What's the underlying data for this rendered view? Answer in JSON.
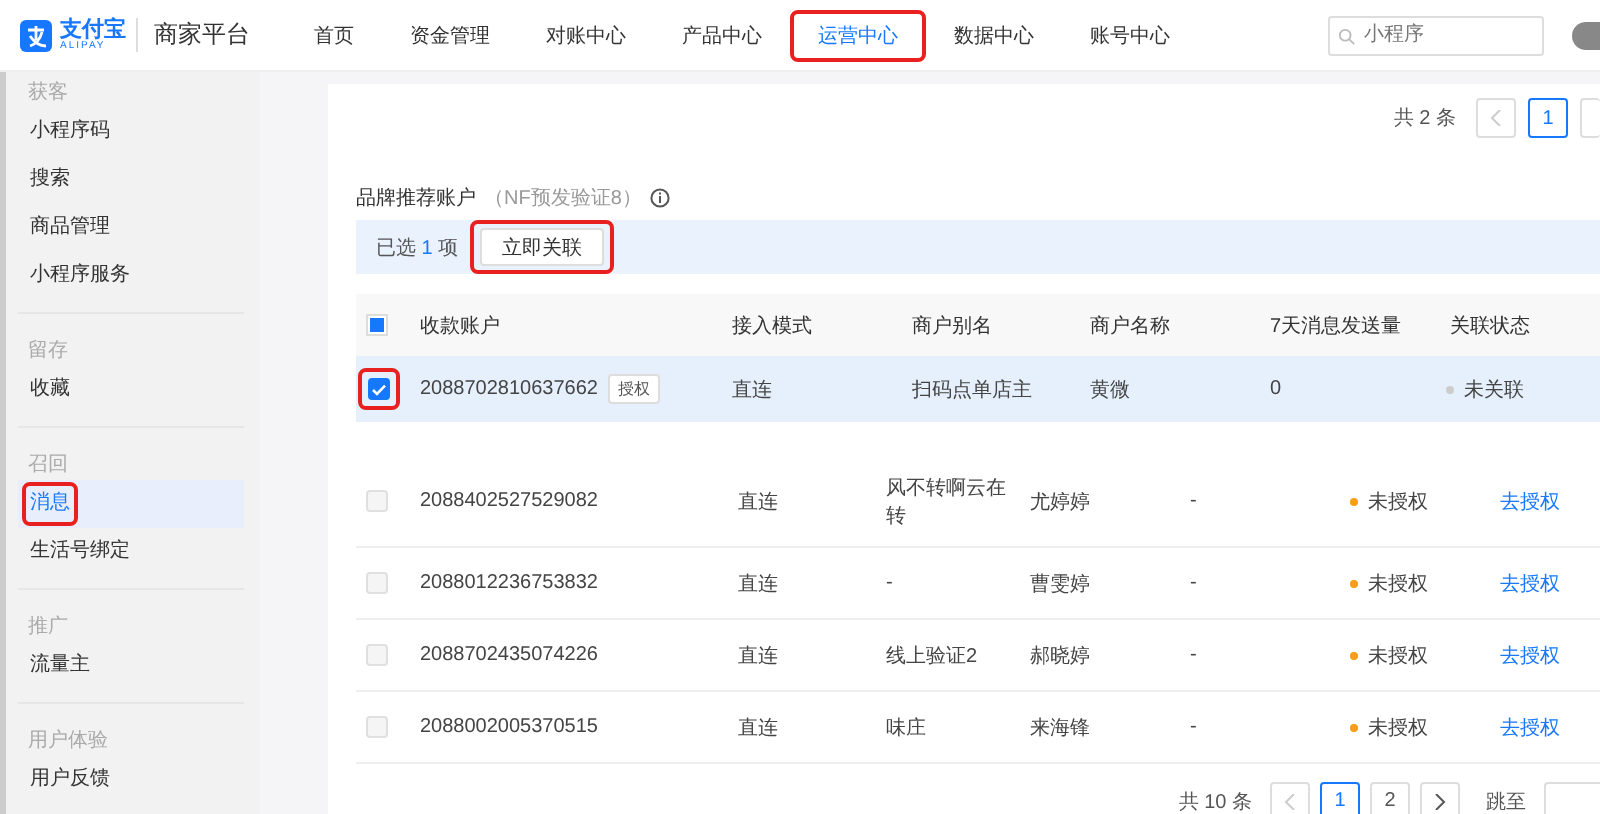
{
  "header": {
    "logo_text": "支付宝",
    "logo_sub": "ALIPAY",
    "product": "商家平台",
    "nav": [
      {
        "label": "首页",
        "selected": false,
        "highlighted": false
      },
      {
        "label": "资金管理",
        "selected": false,
        "highlighted": false
      },
      {
        "label": "对账中心",
        "selected": false,
        "highlighted": false
      },
      {
        "label": "产品中心",
        "selected": false,
        "highlighted": false
      },
      {
        "label": "运营中心",
        "selected": true,
        "highlighted": true
      },
      {
        "label": "数据中心",
        "selected": false,
        "highlighted": false
      },
      {
        "label": "账号中心",
        "selected": false,
        "highlighted": false
      }
    ],
    "search": {
      "placeholder": "小程序"
    }
  },
  "sidebar": {
    "groups": [
      {
        "title": "获客",
        "items": [
          {
            "label": "小程序码",
            "selected": false,
            "highlighted": false
          },
          {
            "label": "搜索",
            "selected": false,
            "highlighted": false
          },
          {
            "label": "商品管理",
            "selected": false,
            "highlighted": false
          },
          {
            "label": "小程序服务",
            "selected": false,
            "highlighted": false
          }
        ]
      },
      {
        "title": "留存",
        "items": [
          {
            "label": "收藏",
            "selected": false,
            "highlighted": false
          }
        ]
      },
      {
        "title": "召回",
        "items": [
          {
            "label": "消息",
            "selected": true,
            "highlighted": true
          },
          {
            "label": "生活号绑定",
            "selected": false,
            "highlighted": false
          }
        ]
      },
      {
        "title": "推广",
        "items": [
          {
            "label": "流量主",
            "selected": false,
            "highlighted": false
          }
        ]
      },
      {
        "title": "用户体验",
        "items": [
          {
            "label": "用户反馈",
            "selected": false,
            "highlighted": false
          }
        ]
      }
    ]
  },
  "top_pagination": {
    "total": "共 2 条",
    "pages": [
      {
        "label": "1",
        "selected": true
      }
    ]
  },
  "section": {
    "title": "品牌推荐账户",
    "subtitle": "（NF预发验证8）"
  },
  "selection_bar": {
    "prefix": "已选",
    "count": "1",
    "suffix": "项",
    "button": {
      "label": "立即关联",
      "highlighted": true
    }
  },
  "selected_table": {
    "indeterminate": true,
    "columns": [
      "收款账户",
      "接入模式",
      "商户别名",
      "商户名称",
      "7天消息发送量",
      "关联状态"
    ],
    "rows": [
      {
        "checked": true,
        "highlighted": true,
        "account": "2088702810637662",
        "tag": "授权",
        "mode": "直连",
        "alias": "扫码点单店主",
        "name": "黄微",
        "sent": "0",
        "status": "未关联",
        "color": "#cccccc"
      }
    ]
  },
  "accounts_table": {
    "rows": [
      {
        "checked": false,
        "account": "2088402527529082",
        "mode": "直连",
        "alias": "风不转啊云在转",
        "name": "尤婷婷",
        "sent": "-",
        "status": "未授权",
        "color": "#fa9d14",
        "action": "去授权"
      },
      {
        "checked": false,
        "account": "2088012236753832",
        "mode": "直连",
        "alias": "-",
        "name": "曹雯婷",
        "sent": "-",
        "status": "未授权",
        "color": "#fa9d14",
        "action": "去授权"
      },
      {
        "checked": false,
        "account": "2088702435074226",
        "mode": "直连",
        "alias": "线上验证2",
        "name": "郝晓婷",
        "sent": "-",
        "status": "未授权",
        "color": "#fa9d14",
        "action": "去授权"
      },
      {
        "checked": false,
        "account": "2088002005370515",
        "mode": "直连",
        "alias": "味庄",
        "name": "来海锋",
        "sent": "-",
        "status": "未授权",
        "color": "#fa9d14",
        "action": "去授权"
      }
    ]
  },
  "bottom_pagination": {
    "total": "共 10 条",
    "pages": [
      {
        "label": "1",
        "selected": true
      },
      {
        "label": "2",
        "selected": false
      }
    ],
    "jump_label": "跳至"
  }
}
